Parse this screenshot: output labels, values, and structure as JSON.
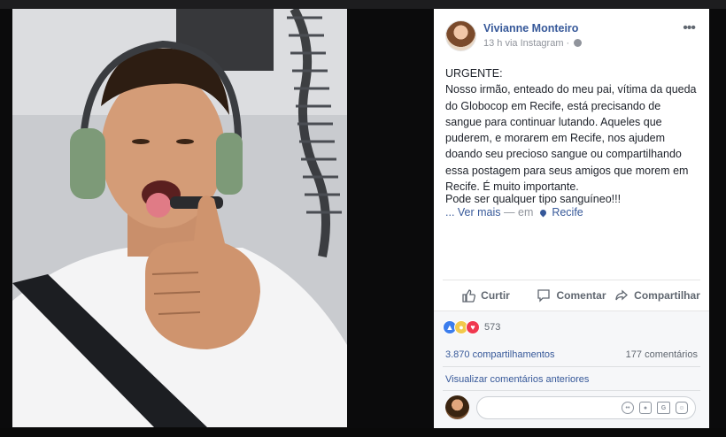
{
  "post": {
    "author": "Vivianne Monteiro",
    "meta": "13 h via Instagram ·",
    "text": "URGENTE:\nNosso irmão, enteado do meu pai, vítima da queda do Globocop em Recife, está precisando de sangue para continuar lutando. Aqueles que puderem, e morarem em Recife, nos ajudem doando seu precioso sangue ou compartilhando essa postagem para seus amigos que morem em Recife. É muito importante.",
    "text2": "Pode ser qualquer tipo sanguíneo!!!",
    "see_more": "... Ver mais",
    "location_prefix": "— em",
    "location": "Recife"
  },
  "actions": {
    "like": "Curtir",
    "comment": "Comentar",
    "share": "Compartilhar"
  },
  "stats": {
    "reaction_count": "573",
    "shares": "3.870 compartilhamentos",
    "comments": "177 comentários",
    "view_previous": "Visualizar comentários anteriores"
  },
  "comment_box": {
    "placeholder": ""
  },
  "icons": {
    "header_menu": "more-options-icon",
    "privacy": "globe-icon",
    "location": "map-pin-icon"
  },
  "colors": {
    "link": "#365899",
    "like_blue": "#3b7ded",
    "sad_yellow": "#f2c94c",
    "love_red": "#f0384f"
  }
}
